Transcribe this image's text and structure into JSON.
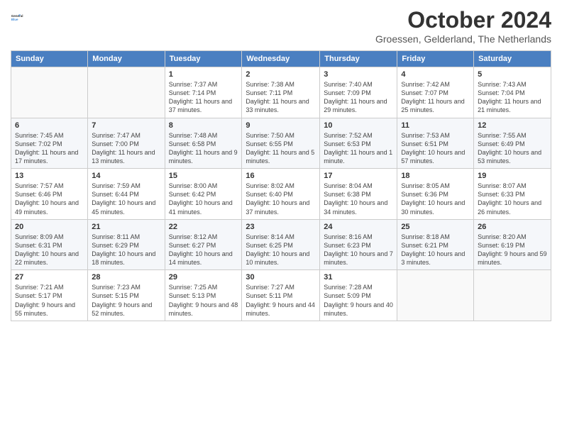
{
  "logo": {
    "line1": "General",
    "line2": "Blue"
  },
  "title": "October 2024",
  "subtitle": "Groessen, Gelderland, The Netherlands",
  "days_of_week": [
    "Sunday",
    "Monday",
    "Tuesday",
    "Wednesday",
    "Thursday",
    "Friday",
    "Saturday"
  ],
  "weeks": [
    [
      {
        "day": "",
        "sunrise": "",
        "sunset": "",
        "daylight": ""
      },
      {
        "day": "",
        "sunrise": "",
        "sunset": "",
        "daylight": ""
      },
      {
        "day": "1",
        "sunrise": "Sunrise: 7:37 AM",
        "sunset": "Sunset: 7:14 PM",
        "daylight": "Daylight: 11 hours and 37 minutes."
      },
      {
        "day": "2",
        "sunrise": "Sunrise: 7:38 AM",
        "sunset": "Sunset: 7:11 PM",
        "daylight": "Daylight: 11 hours and 33 minutes."
      },
      {
        "day": "3",
        "sunrise": "Sunrise: 7:40 AM",
        "sunset": "Sunset: 7:09 PM",
        "daylight": "Daylight: 11 hours and 29 minutes."
      },
      {
        "day": "4",
        "sunrise": "Sunrise: 7:42 AM",
        "sunset": "Sunset: 7:07 PM",
        "daylight": "Daylight: 11 hours and 25 minutes."
      },
      {
        "day": "5",
        "sunrise": "Sunrise: 7:43 AM",
        "sunset": "Sunset: 7:04 PM",
        "daylight": "Daylight: 11 hours and 21 minutes."
      }
    ],
    [
      {
        "day": "6",
        "sunrise": "Sunrise: 7:45 AM",
        "sunset": "Sunset: 7:02 PM",
        "daylight": "Daylight: 11 hours and 17 minutes."
      },
      {
        "day": "7",
        "sunrise": "Sunrise: 7:47 AM",
        "sunset": "Sunset: 7:00 PM",
        "daylight": "Daylight: 11 hours and 13 minutes."
      },
      {
        "day": "8",
        "sunrise": "Sunrise: 7:48 AM",
        "sunset": "Sunset: 6:58 PM",
        "daylight": "Daylight: 11 hours and 9 minutes."
      },
      {
        "day": "9",
        "sunrise": "Sunrise: 7:50 AM",
        "sunset": "Sunset: 6:55 PM",
        "daylight": "Daylight: 11 hours and 5 minutes."
      },
      {
        "day": "10",
        "sunrise": "Sunrise: 7:52 AM",
        "sunset": "Sunset: 6:53 PM",
        "daylight": "Daylight: 11 hours and 1 minute."
      },
      {
        "day": "11",
        "sunrise": "Sunrise: 7:53 AM",
        "sunset": "Sunset: 6:51 PM",
        "daylight": "Daylight: 10 hours and 57 minutes."
      },
      {
        "day": "12",
        "sunrise": "Sunrise: 7:55 AM",
        "sunset": "Sunset: 6:49 PM",
        "daylight": "Daylight: 10 hours and 53 minutes."
      }
    ],
    [
      {
        "day": "13",
        "sunrise": "Sunrise: 7:57 AM",
        "sunset": "Sunset: 6:46 PM",
        "daylight": "Daylight: 10 hours and 49 minutes."
      },
      {
        "day": "14",
        "sunrise": "Sunrise: 7:59 AM",
        "sunset": "Sunset: 6:44 PM",
        "daylight": "Daylight: 10 hours and 45 minutes."
      },
      {
        "day": "15",
        "sunrise": "Sunrise: 8:00 AM",
        "sunset": "Sunset: 6:42 PM",
        "daylight": "Daylight: 10 hours and 41 minutes."
      },
      {
        "day": "16",
        "sunrise": "Sunrise: 8:02 AM",
        "sunset": "Sunset: 6:40 PM",
        "daylight": "Daylight: 10 hours and 37 minutes."
      },
      {
        "day": "17",
        "sunrise": "Sunrise: 8:04 AM",
        "sunset": "Sunset: 6:38 PM",
        "daylight": "Daylight: 10 hours and 34 minutes."
      },
      {
        "day": "18",
        "sunrise": "Sunrise: 8:05 AM",
        "sunset": "Sunset: 6:36 PM",
        "daylight": "Daylight: 10 hours and 30 minutes."
      },
      {
        "day": "19",
        "sunrise": "Sunrise: 8:07 AM",
        "sunset": "Sunset: 6:33 PM",
        "daylight": "Daylight: 10 hours and 26 minutes."
      }
    ],
    [
      {
        "day": "20",
        "sunrise": "Sunrise: 8:09 AM",
        "sunset": "Sunset: 6:31 PM",
        "daylight": "Daylight: 10 hours and 22 minutes."
      },
      {
        "day": "21",
        "sunrise": "Sunrise: 8:11 AM",
        "sunset": "Sunset: 6:29 PM",
        "daylight": "Daylight: 10 hours and 18 minutes."
      },
      {
        "day": "22",
        "sunrise": "Sunrise: 8:12 AM",
        "sunset": "Sunset: 6:27 PM",
        "daylight": "Daylight: 10 hours and 14 minutes."
      },
      {
        "day": "23",
        "sunrise": "Sunrise: 8:14 AM",
        "sunset": "Sunset: 6:25 PM",
        "daylight": "Daylight: 10 hours and 10 minutes."
      },
      {
        "day": "24",
        "sunrise": "Sunrise: 8:16 AM",
        "sunset": "Sunset: 6:23 PM",
        "daylight": "Daylight: 10 hours and 7 minutes."
      },
      {
        "day": "25",
        "sunrise": "Sunrise: 8:18 AM",
        "sunset": "Sunset: 6:21 PM",
        "daylight": "Daylight: 10 hours and 3 minutes."
      },
      {
        "day": "26",
        "sunrise": "Sunrise: 8:20 AM",
        "sunset": "Sunset: 6:19 PM",
        "daylight": "Daylight: 9 hours and 59 minutes."
      }
    ],
    [
      {
        "day": "27",
        "sunrise": "Sunrise: 7:21 AM",
        "sunset": "Sunset: 5:17 PM",
        "daylight": "Daylight: 9 hours and 55 minutes."
      },
      {
        "day": "28",
        "sunrise": "Sunrise: 7:23 AM",
        "sunset": "Sunset: 5:15 PM",
        "daylight": "Daylight: 9 hours and 52 minutes."
      },
      {
        "day": "29",
        "sunrise": "Sunrise: 7:25 AM",
        "sunset": "Sunset: 5:13 PM",
        "daylight": "Daylight: 9 hours and 48 minutes."
      },
      {
        "day": "30",
        "sunrise": "Sunrise: 7:27 AM",
        "sunset": "Sunset: 5:11 PM",
        "daylight": "Daylight: 9 hours and 44 minutes."
      },
      {
        "day": "31",
        "sunrise": "Sunrise: 7:28 AM",
        "sunset": "Sunset: 5:09 PM",
        "daylight": "Daylight: 9 hours and 40 minutes."
      },
      {
        "day": "",
        "sunrise": "",
        "sunset": "",
        "daylight": ""
      },
      {
        "day": "",
        "sunrise": "",
        "sunset": "",
        "daylight": ""
      }
    ]
  ]
}
